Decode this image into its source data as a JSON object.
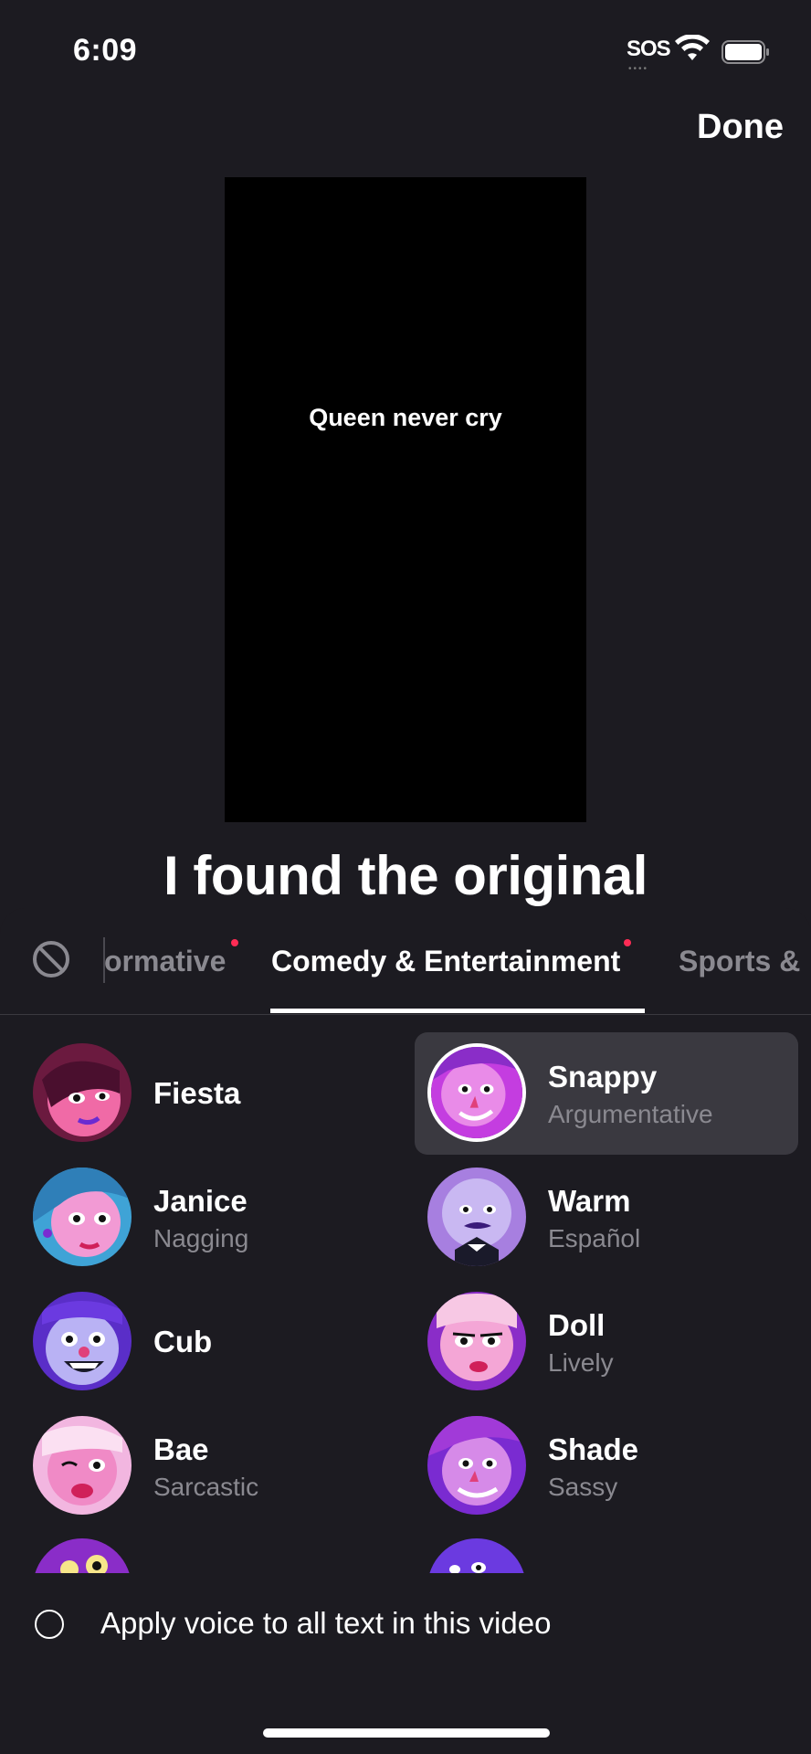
{
  "status_bar": {
    "time": "6:09",
    "sos": "SOS"
  },
  "header": {
    "done_label": "Done"
  },
  "preview": {
    "caption": "Queen never cry"
  },
  "overlay_text": "I found the original",
  "tabs": [
    {
      "label": "ormative",
      "new": true
    },
    {
      "label": "Comedy & Entertainment",
      "new": true,
      "active": true
    },
    {
      "label": "Sports &",
      "new": false
    }
  ],
  "voices": [
    {
      "name": "Fiesta",
      "subtitle": "",
      "selected": false
    },
    {
      "name": "Snappy",
      "subtitle": "Argumentative",
      "selected": true
    },
    {
      "name": "Janice",
      "subtitle": "Nagging",
      "selected": false
    },
    {
      "name": "Warm",
      "subtitle": "Español",
      "selected": false
    },
    {
      "name": "Cub",
      "subtitle": "",
      "selected": false
    },
    {
      "name": "Doll",
      "subtitle": "Lively",
      "selected": false
    },
    {
      "name": "Bae",
      "subtitle": "Sarcastic",
      "selected": false
    },
    {
      "name": "Shade",
      "subtitle": "Sassy",
      "selected": false
    }
  ],
  "apply": {
    "label": "Apply voice to all text in this video",
    "checked": false
  },
  "colors": {
    "background": "#1c1b21",
    "accent": "#fe2c55",
    "selected_bg": "#3a3940",
    "muted_text": "#8a8990"
  }
}
